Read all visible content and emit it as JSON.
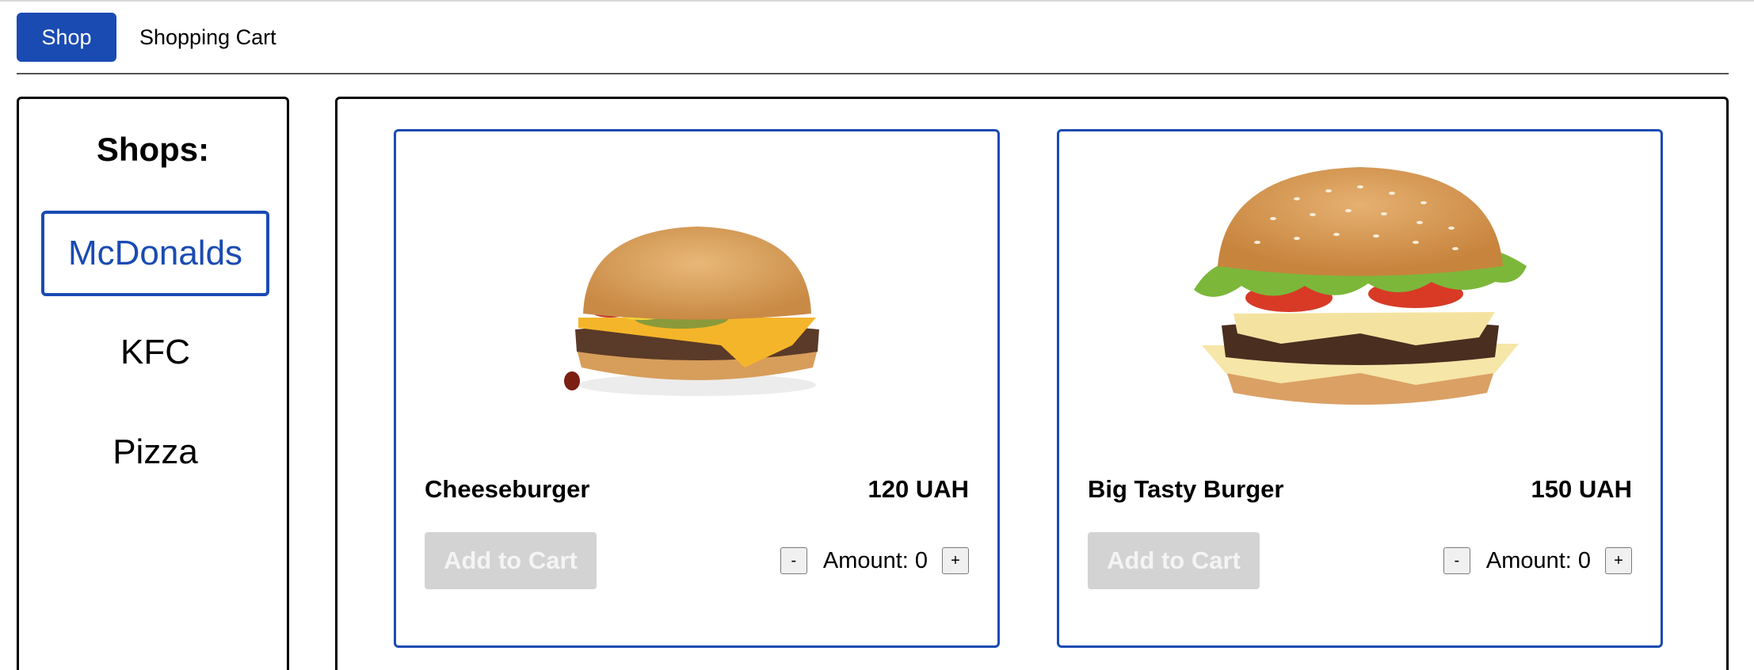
{
  "nav": {
    "shop_label": "Shop",
    "cart_label": "Shopping Cart"
  },
  "sidebar": {
    "title": "Shops:",
    "items": [
      {
        "label": "McDonalds",
        "active": true
      },
      {
        "label": "KFC",
        "active": false
      },
      {
        "label": "Pizza",
        "active": false
      }
    ]
  },
  "products": [
    {
      "name": "Cheeseburger",
      "price": "120 UAH",
      "add_label": "Add to Cart",
      "amount_label": "Amount:",
      "amount": "0",
      "decrement": "-",
      "increment": "+",
      "image": "cheeseburger-photo"
    },
    {
      "name": "Big Tasty Burger",
      "price": "150 UAH",
      "add_label": "Add to Cart",
      "amount_label": "Amount:",
      "amount": "0",
      "decrement": "-",
      "increment": "+",
      "image": "big-tasty-burger-photo"
    }
  ],
  "colors": {
    "accent": "#1a4bb3",
    "disabled_button": "#d3d3d3"
  }
}
